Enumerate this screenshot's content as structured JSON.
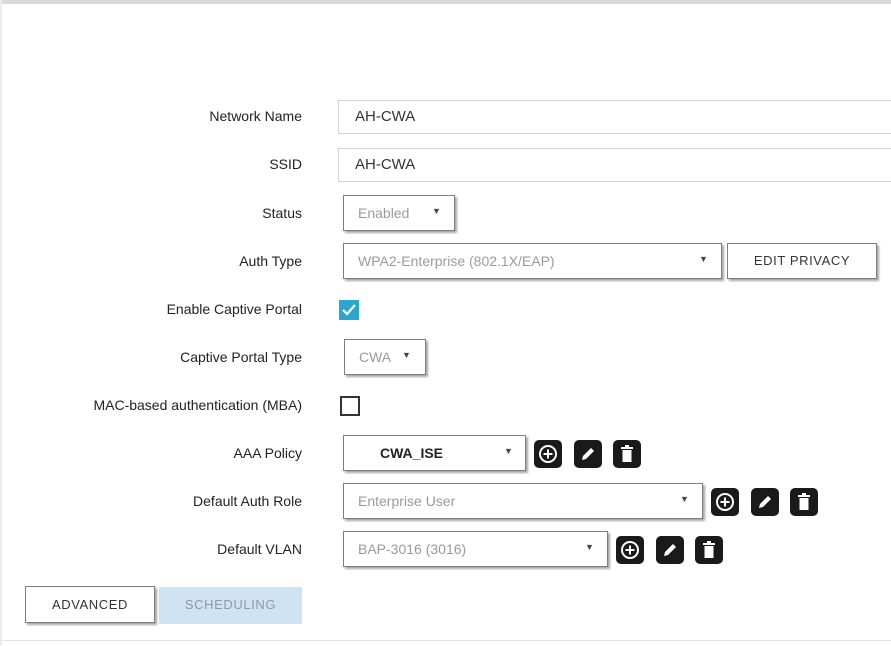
{
  "form": {
    "network_name": {
      "label": "Network Name",
      "value": "AH-CWA"
    },
    "ssid": {
      "label": "SSID",
      "value": "AH-CWA"
    },
    "status": {
      "label": "Status",
      "value": "Enabled"
    },
    "auth_type": {
      "label": "Auth Type",
      "value": "WPA2-Enterprise (802.1X/EAP)",
      "button": "EDIT PRIVACY"
    },
    "captive_portal": {
      "label": "Enable Captive Portal",
      "checked": true
    },
    "captive_portal_type": {
      "label": "Captive Portal Type",
      "value": "CWA"
    },
    "mba": {
      "label": "MAC-based authentication (MBA)",
      "checked": false
    },
    "aaa_policy": {
      "label": "AAA Policy",
      "value": "CWA_ISE"
    },
    "default_auth_role": {
      "label": "Default Auth Role",
      "value": "Enterprise User"
    },
    "default_vlan": {
      "label": "Default VLAN",
      "value": "BAP-3016 (3016)"
    }
  },
  "icons": {
    "add": "plus-circle-icon",
    "edit": "pencil-icon",
    "delete": "trash-icon",
    "dropdown": "caret-down-icon"
  },
  "tabs": {
    "advanced": "ADVANCED",
    "scheduling": "SCHEDULING"
  },
  "colors": {
    "checkbox_accent": "#2aa6cf",
    "icon_button_bg": "#1a1a1a",
    "scheduling_tab_bg": "#cfe3f2"
  }
}
